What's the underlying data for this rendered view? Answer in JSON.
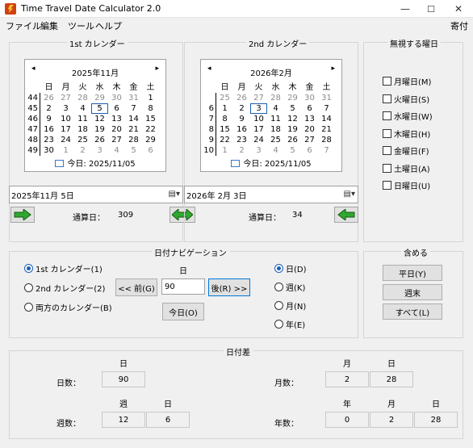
{
  "app": {
    "title": "Time Travel Date Calculator 2.0",
    "minimize": "—",
    "maximize": "☐",
    "close": "✕"
  },
  "menu": {
    "file": "ファイル",
    "edit": "編集",
    "tools": "ツール",
    "help": "ヘルプ",
    "donate": "寄付"
  },
  "cal1": {
    "group_title": "1st カレンダー",
    "header": "2025年11月",
    "prev": "◂",
    "next": "▸",
    "weekday_headers": [
      "日",
      "月",
      "火",
      "水",
      "木",
      "金",
      "土"
    ],
    "weeks": [
      {
        "wk": "44",
        "days": [
          "26",
          "27",
          "28",
          "29",
          "30",
          "31",
          "1"
        ]
      },
      {
        "wk": "45",
        "days": [
          "2",
          "3",
          "4",
          "5",
          "6",
          "7",
          "8"
        ]
      },
      {
        "wk": "46",
        "days": [
          "9",
          "10",
          "11",
          "12",
          "13",
          "14",
          "15"
        ]
      },
      {
        "wk": "47",
        "days": [
          "16",
          "17",
          "18",
          "19",
          "20",
          "21",
          "22"
        ]
      },
      {
        "wk": "48",
        "days": [
          "23",
          "24",
          "25",
          "26",
          "27",
          "28",
          "29"
        ]
      },
      {
        "wk": "49",
        "days": [
          "30",
          "1",
          "2",
          "3",
          "4",
          "5",
          "6"
        ]
      }
    ],
    "today": "今日: 2025/11/05",
    "date_value": "2025年11月  5日",
    "serial_label": "通算日：",
    "serial_value": "309"
  },
  "cal2": {
    "group_title": "2nd カレンダー",
    "header": "2026年2月",
    "prev": "◂",
    "next": "▸",
    "weekday_headers": [
      "日",
      "月",
      "火",
      "水",
      "木",
      "金",
      "土"
    ],
    "weeks": [
      {
        "wk": "",
        "days": [
          "25",
          "26",
          "27",
          "28",
          "29",
          "30",
          "31"
        ]
      },
      {
        "wk": "6",
        "days": [
          "1",
          "2",
          "3",
          "4",
          "5",
          "6",
          "7"
        ]
      },
      {
        "wk": "7",
        "days": [
          "8",
          "9",
          "10",
          "11",
          "12",
          "13",
          "14"
        ]
      },
      {
        "wk": "8",
        "days": [
          "15",
          "16",
          "17",
          "18",
          "19",
          "20",
          "21"
        ]
      },
      {
        "wk": "9",
        "days": [
          "22",
          "23",
          "24",
          "25",
          "26",
          "27",
          "28"
        ]
      },
      {
        "wk": "10",
        "days": [
          "1",
          "2",
          "3",
          "4",
          "5",
          "6",
          "7"
        ]
      }
    ],
    "today": "今日: 2025/11/05",
    "date_value": "2026年  2月  3日",
    "serial_label": "通算日：",
    "serial_value": "34"
  },
  "ignore": {
    "group_title": "無視する曜日",
    "items": [
      "月曜日(M)",
      "火曜日(S)",
      "水曜日(W)",
      "木曜日(H)",
      "金曜日(F)",
      "土曜日(A)",
      "日曜日(U)"
    ]
  },
  "nav": {
    "group_title": "日付ナビゲーション",
    "cal_options": [
      "1st カレンダー(1)",
      "2nd カレンダー(2)",
      "両方のカレンダー(B)"
    ],
    "selected_cal": 0,
    "day_label": "日",
    "day_value": "90",
    "prev_button": "<< 前(G)",
    "next_button": "後(R) >>",
    "today_button": "今日(O)",
    "unit_options": [
      "日(D)",
      "週(K)",
      "月(N)",
      "年(E)"
    ],
    "selected_unit": 0
  },
  "include": {
    "group_title": "含める",
    "weekdays": "平日(Y)",
    "weekend": "週末",
    "all": "すべて(L)"
  },
  "diff": {
    "group_title": "日付差",
    "days_label": "日数：",
    "day_header": "日",
    "days_value": "90",
    "months_label": "月数：",
    "month_header": "月",
    "day_header2": "日",
    "months_value": "2",
    "months_days_value": "28",
    "weeks_label": "週数：",
    "week_header": "週",
    "day_header3": "日",
    "weeks_value": "12",
    "weeks_days_value": "6",
    "years_label": "年数：",
    "year_header": "年",
    "month_header2": "月",
    "day_header4": "日",
    "years_value": "0",
    "years_months_value": "2",
    "years_days_value": "28"
  },
  "colors": {
    "arrow_green": "#2ea82e",
    "selection_blue": "#1a5fb4",
    "title_icon": "#d04010"
  }
}
